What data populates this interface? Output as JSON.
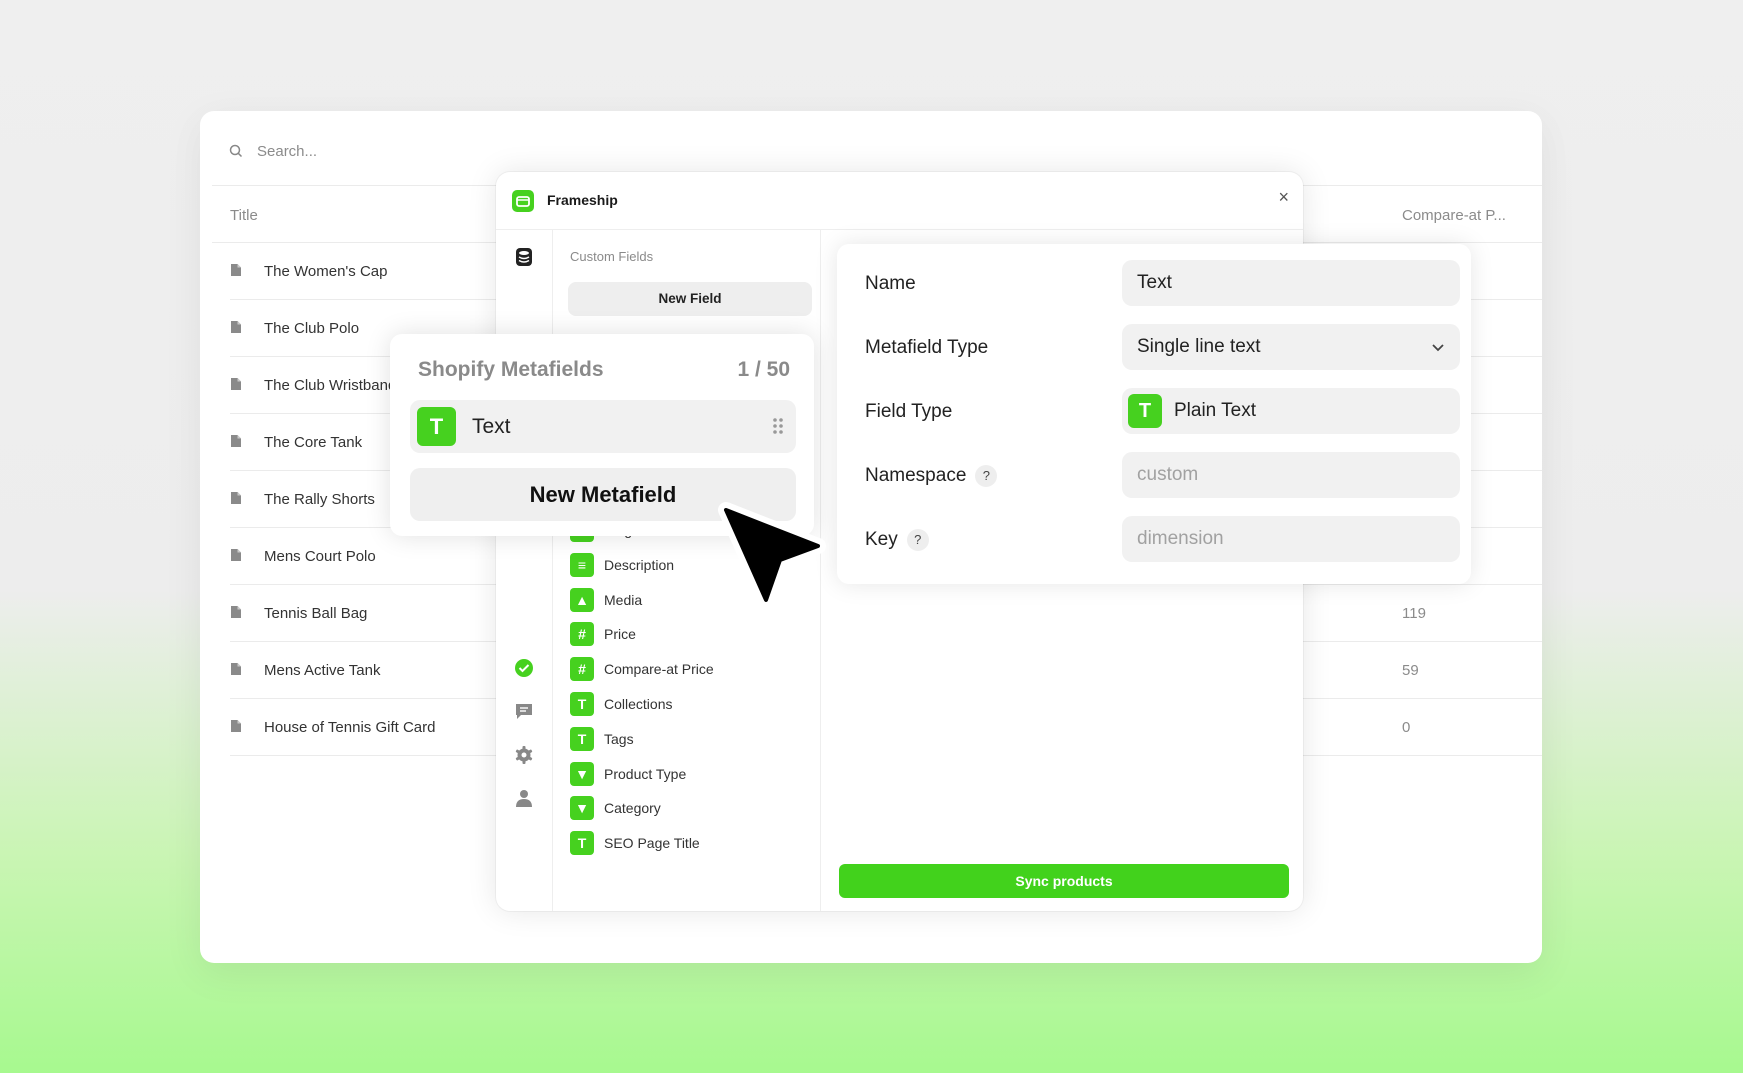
{
  "background_table": {
    "search_placeholder": "Search...",
    "col_title": "Title",
    "col_compare": "Compare-at P...",
    "rows": [
      {
        "title": "The Women's Cap",
        "compare": ""
      },
      {
        "title": "The Club Polo",
        "compare": ""
      },
      {
        "title": "The Club Wristband",
        "compare": ""
      },
      {
        "title": "The Core Tank",
        "compare": ""
      },
      {
        "title": "The Rally Shorts",
        "compare": ""
      },
      {
        "title": "Mens Court Polo",
        "compare": ""
      },
      {
        "title": "Tennis Ball Bag",
        "compare": "119"
      },
      {
        "title": "Mens Active Tank",
        "compare": "59"
      },
      {
        "title": "House of Tennis Gift Card",
        "compare": "0"
      }
    ]
  },
  "plugin": {
    "title": "Frameship",
    "close": "×",
    "section_label": "Custom Fields",
    "new_field": "New Field",
    "fields": [
      {
        "icon": "/",
        "label": "Slug"
      },
      {
        "icon": "≡",
        "label": "Description"
      },
      {
        "icon": "▲",
        "label": "Media"
      },
      {
        "icon": "#",
        "label": "Price"
      },
      {
        "icon": "#",
        "label": "Compare-at Price"
      },
      {
        "icon": "T",
        "label": "Collections"
      },
      {
        "icon": "T",
        "label": "Tags"
      },
      {
        "icon": "▼",
        "label": "Product Type"
      },
      {
        "icon": "▼",
        "label": "Category"
      },
      {
        "icon": "T",
        "label": "SEO Page Title"
      }
    ],
    "sync_button": "Sync products",
    "accent": "#46d11f"
  },
  "form": {
    "name_label": "Name",
    "name_value": "Text",
    "metafield_type_label": "Metafield Type",
    "metafield_type_value": "Single line text",
    "field_type_label": "Field Type",
    "field_type_icon": "T",
    "field_type_value": "Plain Text",
    "namespace_label": "Namespace",
    "namespace_placeholder": "custom",
    "key_label": "Key",
    "key_placeholder": "dimension",
    "help": "?"
  },
  "metafields_panel": {
    "title": "Shopify Metafields",
    "count": "1 / 50",
    "item_icon": "T",
    "item_label": "Text",
    "new_button": "New Metafield"
  }
}
